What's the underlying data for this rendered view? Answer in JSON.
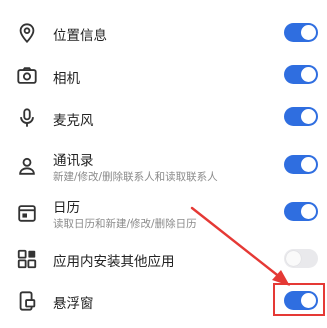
{
  "rows": [
    {
      "title": "位置信息",
      "icon": "location-pin-icon",
      "toggle": "on"
    },
    {
      "title": "相机",
      "icon": "camera-icon",
      "toggle": "on"
    },
    {
      "title": "麦克风",
      "icon": "microphone-icon",
      "toggle": "on"
    },
    {
      "title": "通讯录",
      "subtitle": "新建/修改/删除联系人和读取联系人",
      "icon": "contacts-person-icon",
      "toggle": "on"
    },
    {
      "title": "日历",
      "subtitle": "读取日历和新建/修改/删除日历",
      "icon": "calendar-icon",
      "toggle": "on"
    },
    {
      "title": "应用内安装其他应用",
      "icon": "app-grid-icon",
      "toggle": "off"
    },
    {
      "title": "悬浮窗",
      "icon": "floating-window-icon",
      "toggle": "on"
    }
  ],
  "colors": {
    "toggle_on": "#2f6ee0",
    "toggle_off": "#e9e9ec",
    "annotation": "#e53935"
  },
  "annotation": {
    "highlight_target": "悬浮窗 toggle",
    "arrow": "red arrow pointing to highlighted toggle"
  }
}
